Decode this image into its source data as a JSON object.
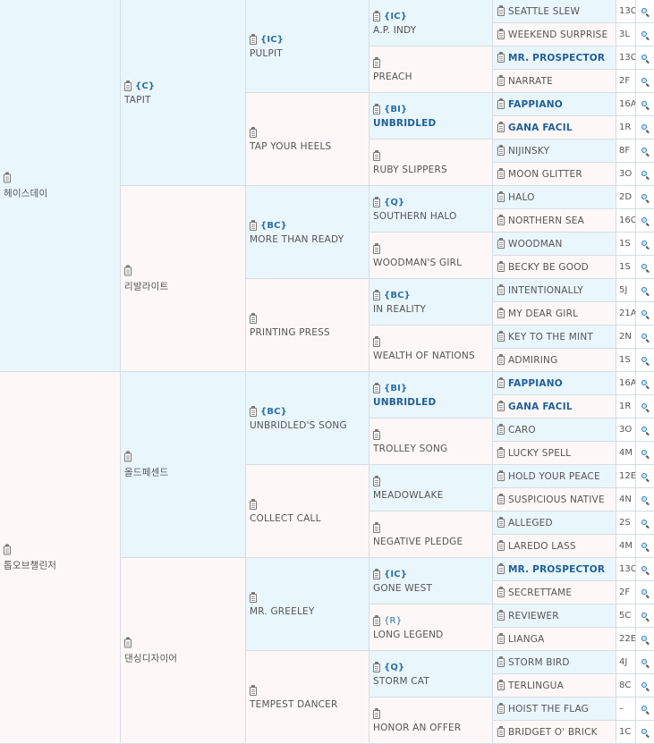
{
  "g1": [
    {
      "name": "헤이스데이",
      "note": ""
    },
    {
      "name": "톱오브챌린저",
      "note": ""
    }
  ],
  "g2": [
    {
      "name": "TAPIT",
      "note": "{C}"
    },
    {
      "name": "리발라이트",
      "note": ""
    },
    {
      "name": "올드페센드",
      "note": ""
    },
    {
      "name": "댄싱디자이어",
      "note": ""
    }
  ],
  "g3": [
    {
      "name": "PULPIT",
      "note": "{IC}"
    },
    {
      "name": "TAP YOUR HEELS",
      "note": ""
    },
    {
      "name": "MORE THAN READY",
      "note": "{BC}"
    },
    {
      "name": "PRINTING PRESS",
      "note": ""
    },
    {
      "name": "UNBRIDLED'S SONG",
      "note": "{BC}"
    },
    {
      "name": "COLLECT CALL",
      "note": ""
    },
    {
      "name": "MR. GREELEY",
      "note": ""
    },
    {
      "name": "TEMPEST DANCER",
      "note": ""
    }
  ],
  "g4": [
    {
      "name": "A.P. INDY",
      "note": "{IC}",
      "bold": false
    },
    {
      "name": "PREACH",
      "note": "",
      "bold": false
    },
    {
      "name": "UNBRIDLED",
      "note": "{BI}",
      "bold": true
    },
    {
      "name": "RUBY SLIPPERS",
      "note": "",
      "bold": false
    },
    {
      "name": "SOUTHERN HALO",
      "note": "{Q}",
      "bold": false
    },
    {
      "name": "WOODMAN'S GIRL",
      "note": "",
      "bold": false
    },
    {
      "name": "IN REALITY",
      "note": "{BC}",
      "bold": false
    },
    {
      "name": "WEALTH OF NATIONS",
      "note": "",
      "bold": false
    },
    {
      "name": "UNBRIDLED",
      "note": "{BI}",
      "bold": true
    },
    {
      "name": "TROLLEY SONG",
      "note": "",
      "bold": false
    },
    {
      "name": "MEADOWLAKE",
      "note": "",
      "bold": false
    },
    {
      "name": "NEGATIVE PLEDGE",
      "note": "",
      "bold": false
    },
    {
      "name": "GONE WEST",
      "note": "{IC}",
      "bold": false
    },
    {
      "name": "LONG LEGEND",
      "note": "{R}",
      "bold": false
    },
    {
      "name": "STORM CAT",
      "note": "{Q}",
      "bold": false
    },
    {
      "name": "HONOR AN OFFER",
      "note": "",
      "bold": false
    }
  ],
  "g5": [
    {
      "name": "SEATTLE SLEW",
      "code": "13C",
      "bold": false
    },
    {
      "name": "WEEKEND SURPRISE",
      "code": "3L",
      "bold": false
    },
    {
      "name": "MR. PROSPECTOR",
      "code": "13C",
      "bold": true
    },
    {
      "name": "NARRATE",
      "code": "2F",
      "bold": false
    },
    {
      "name": "FAPPIANO",
      "code": "16A",
      "bold": true
    },
    {
      "name": "GANA FACIL",
      "code": "1R",
      "bold": true
    },
    {
      "name": "NIJINSKY",
      "code": "8F",
      "bold": false
    },
    {
      "name": "MOON GLITTER",
      "code": "3O",
      "bold": false
    },
    {
      "name": "HALO",
      "code": "2D",
      "bold": false
    },
    {
      "name": "NORTHERN SEA",
      "code": "16C",
      "bold": false
    },
    {
      "name": "WOODMAN",
      "code": "1S",
      "bold": false
    },
    {
      "name": "BECKY BE GOOD",
      "code": "1S",
      "bold": false
    },
    {
      "name": "INTENTIONALLY",
      "code": "5J",
      "bold": false
    },
    {
      "name": "MY DEAR GIRL",
      "code": "21A",
      "bold": false
    },
    {
      "name": "KEY TO THE MINT",
      "code": "2N",
      "bold": false
    },
    {
      "name": "ADMIRING",
      "code": "1S",
      "bold": false
    },
    {
      "name": "FAPPIANO",
      "code": "16A",
      "bold": true
    },
    {
      "name": "GANA FACIL",
      "code": "1R",
      "bold": true
    },
    {
      "name": "CARO",
      "code": "3O",
      "bold": false
    },
    {
      "name": "LUCKY SPELL",
      "code": "4M",
      "bold": false
    },
    {
      "name": "HOLD YOUR PEACE",
      "code": "12E",
      "bold": false
    },
    {
      "name": "SUSPICIOUS NATIVE",
      "code": "4N",
      "bold": false
    },
    {
      "name": "ALLEGED",
      "code": "2S",
      "bold": false
    },
    {
      "name": "LAREDO LASS",
      "code": "4M",
      "bold": false
    },
    {
      "name": "MR. PROSPECTOR",
      "code": "13C",
      "bold": true
    },
    {
      "name": "SECRETTAME",
      "code": "2F",
      "bold": false
    },
    {
      "name": "REVIEWER",
      "code": "5C",
      "bold": false
    },
    {
      "name": "LIANGA",
      "code": "22E",
      "bold": false
    },
    {
      "name": "STORM BIRD",
      "code": "4J",
      "bold": false
    },
    {
      "name": "TERLINGUA",
      "code": "8C",
      "bold": false
    },
    {
      "name": "HOIST THE FLAG",
      "code": "–",
      "bold": false
    },
    {
      "name": "BRIDGET O' BRICK",
      "code": "1C",
      "bold": false
    }
  ],
  "colors": {
    "blue_cell": "#e9f6fc",
    "pink_cell": "#fdf8f7",
    "link": "#1f5f9a",
    "note": "#2b6fa8"
  },
  "icons": {
    "record": "clipboard-icon",
    "search": "magnifier-icon"
  }
}
